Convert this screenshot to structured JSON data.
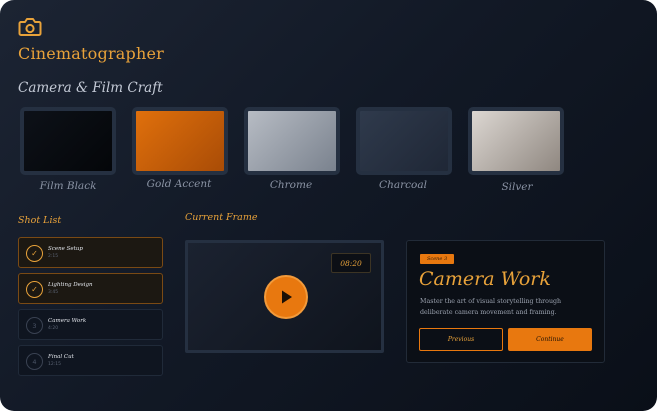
{
  "app": {
    "title": "Cinematographer",
    "icon": "camera-icon"
  },
  "section": {
    "title": "Camera & Film Craft"
  },
  "palette": [
    {
      "label": "Film Black",
      "color": "#0d1118",
      "color2": "#040609"
    },
    {
      "label": "Gold Accent",
      "color": "#e0700c",
      "color2": "#a94c06"
    },
    {
      "label": "Chrome",
      "color": "#b7bcc4",
      "color2": "#7a828e"
    },
    {
      "label": "Charcoal",
      "color": "#2f3a4c",
      "color2": "#1f2736"
    },
    {
      "label": "Silver",
      "color": "#dcd7d2",
      "color2": "#8f8780"
    }
  ],
  "shot_list": {
    "title": "Shot List",
    "items": [
      {
        "name": "Scene Setup",
        "duration": "2:15",
        "status": "done",
        "marker": "✓"
      },
      {
        "name": "Lighting Design",
        "duration": "3:45",
        "status": "done",
        "marker": "✓"
      },
      {
        "name": "Camera Work",
        "duration": "4:20",
        "status": "pending",
        "marker": "3"
      },
      {
        "name": "Final Cut",
        "duration": "12:15",
        "status": "pending",
        "marker": "4"
      }
    ]
  },
  "current_frame": {
    "title": "Current Frame",
    "timecode": "08:20",
    "play_icon": "play-icon"
  },
  "scene_card": {
    "badge": "Scene 3",
    "title": "Camera Work",
    "description": "Master the art of visual storytelling through deliberate camera movement and framing.",
    "prev_label": "Previous",
    "continue_label": "Continue"
  }
}
